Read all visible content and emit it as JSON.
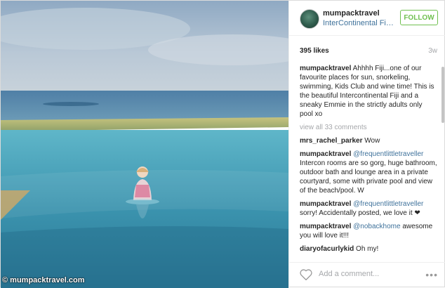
{
  "post": {
    "username": "mumpacktravel",
    "location": "InterContinental Fiji...",
    "follow_label": "FOLLOW",
    "likes": "395 likes",
    "age": "3w",
    "caption_user": "mumpacktravel",
    "caption_text": "Ahhhh Fiji...one of our favourite places for sun, snorkeling, swimming, Kids Club and wine time! This is the beautiful Intercontinental Fiji and a sneaky Emmie in the strictly adults only pool xo",
    "view_all": "view all 33 comments",
    "comments": [
      {
        "user": "mrs_rachel_parker",
        "mention": "",
        "text": "Wow"
      },
      {
        "user": "mumpacktravel",
        "mention": "@frequentlittletraveller",
        "text": "Intercon rooms are so gorg, huge bathroom, outdoor bath and lounge area in a private courtyard, some with private pool and view of the beach/pool. W"
      },
      {
        "user": "mumpacktravel",
        "mention": "@frequentlittletraveller",
        "text": "sorry! Accidentally posted, we love it ❤"
      },
      {
        "user": "mumpacktravel",
        "mention": "@nobackhome",
        "text": "awesome you will love it!!!"
      },
      {
        "user": "diaryofacurlykid",
        "mention": "",
        "text": "Oh my!"
      }
    ],
    "add_comment_placeholder": "Add a comment...",
    "more_label": "•••"
  },
  "watermark": "© mumpacktravel.com",
  "icons": {
    "heart": "heart-icon",
    "more": "more-options-icon"
  },
  "colors": {
    "follow": "#70c050",
    "link": "#3f729b",
    "muted": "#a5a7aa"
  }
}
